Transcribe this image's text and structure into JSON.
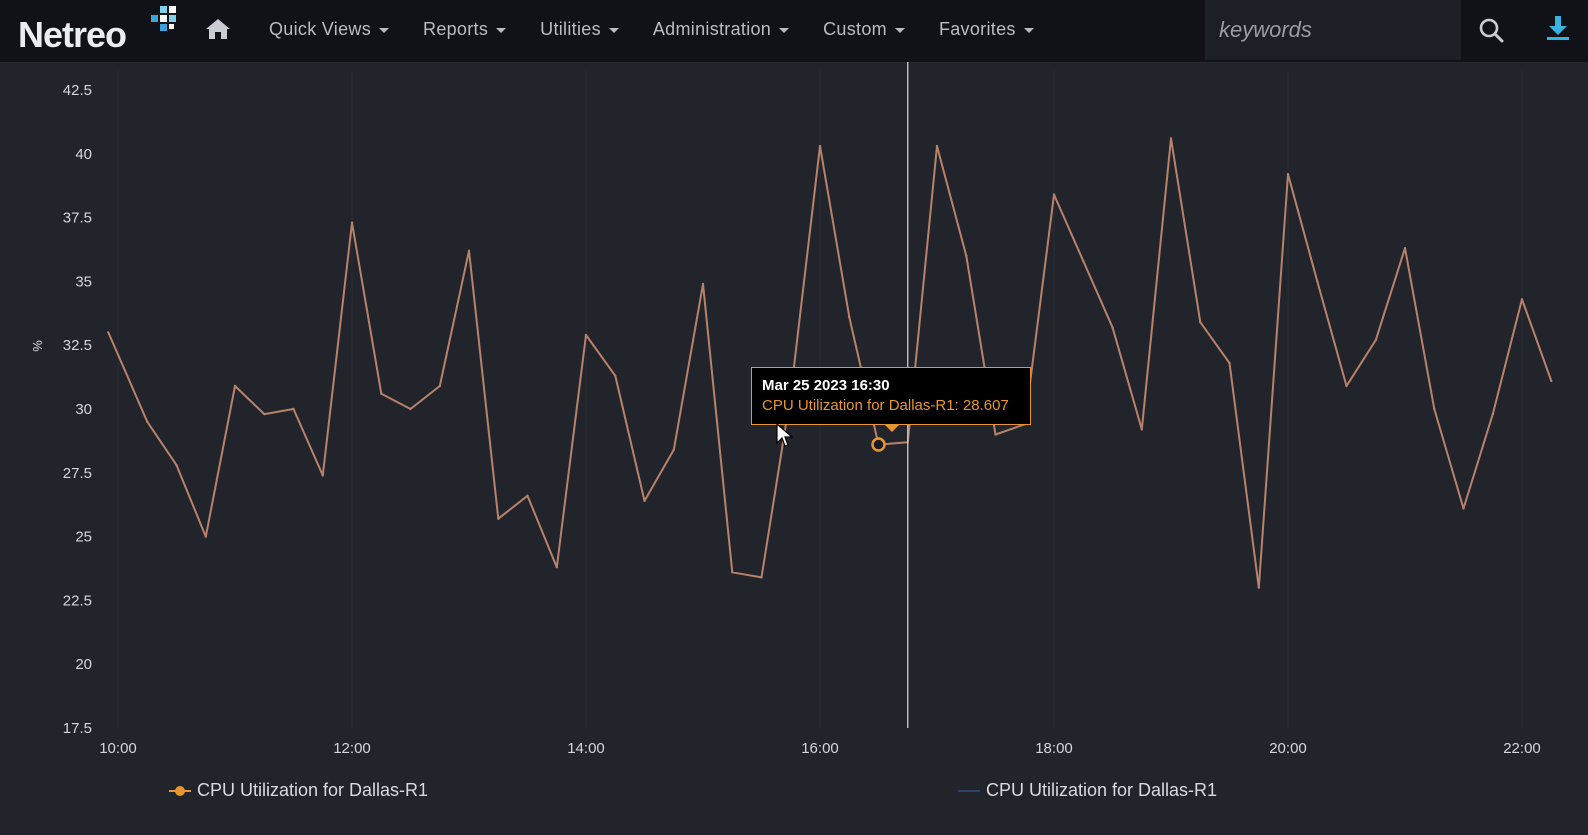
{
  "topbar": {
    "logo_text": "Netreo",
    "nav": [
      {
        "label": "Quick Views"
      },
      {
        "label": "Reports"
      },
      {
        "label": "Utilities"
      },
      {
        "label": "Administration"
      },
      {
        "label": "Custom"
      },
      {
        "label": "Favorites"
      }
    ],
    "search": {
      "placeholder": "keywords",
      "value": ""
    },
    "icons": {
      "home": "home-icon",
      "search": "search-icon",
      "download": "download-icon"
    }
  },
  "colors": {
    "accent": "#e8962f",
    "series_line": "#b8826a",
    "second_series": "#2e4166",
    "background": "#22242c"
  },
  "tooltip": {
    "title": "Mar 25 2023 16:30",
    "value_text": "CPU Utilization for Dallas-R1: 28.607"
  },
  "chart_data": {
    "type": "line",
    "title": "",
    "xlabel": "",
    "ylabel": "%",
    "ylim": [
      17.5,
      42.5
    ],
    "yticks": [
      "17.5",
      "20",
      "22.5",
      "25",
      "27.5",
      "30",
      "32.5",
      "35",
      "37.5",
      "40",
      "42.5"
    ],
    "xlim": [
      "10:00",
      "22:15"
    ],
    "xticks": [
      "10:00",
      "12:00",
      "14:00",
      "16:00",
      "18:00",
      "20:00",
      "22:00"
    ],
    "hover_x": "16:45",
    "marker": {
      "x": "16:30",
      "y": 28.607
    },
    "legend": [
      {
        "label": "CPU Utilization for Dallas-R1",
        "color": "#e8962f"
      },
      {
        "label": "CPU Utilization for Dallas-R1",
        "color": "#2e4166"
      }
    ],
    "series": [
      {
        "x": [
          "09:55",
          "10:15",
          "10:30",
          "10:45",
          "11:00",
          "11:15",
          "11:30",
          "11:45",
          "12:00",
          "12:15",
          "12:30",
          "12:45",
          "13:00",
          "13:15",
          "13:30",
          "13:45",
          "14:00",
          "14:15",
          "14:30",
          "14:45",
          "15:00",
          "15:15",
          "15:30",
          "15:45",
          "16:00",
          "16:15",
          "16:30",
          "16:45",
          "17:00",
          "17:15",
          "17:30",
          "17:45",
          "18:00",
          "18:15",
          "18:30",
          "18:45",
          "19:00",
          "19:15",
          "19:30",
          "19:45",
          "20:00",
          "20:15",
          "20:30",
          "20:45",
          "21:00",
          "21:15",
          "21:30",
          "21:45",
          "22:00",
          "22:15"
        ],
        "values": [
          33,
          29.5,
          27.8,
          25,
          30.9,
          29.8,
          30,
          27.4,
          37.3,
          30.6,
          30,
          30.9,
          36.2,
          25.7,
          26.6,
          23.8,
          32.9,
          31.3,
          26.4,
          28.4,
          34.9,
          23.6,
          23.4,
          30.6,
          40.3,
          33.6,
          28.6,
          28.7,
          40.3,
          36,
          29,
          29.4,
          38.4,
          35.8,
          33.2,
          29.2,
          40.6,
          33.4,
          31.8,
          23,
          39.2,
          35,
          30.9,
          32.7,
          36.3,
          30,
          26.1,
          29.8,
          34.3,
          31.1
        ]
      }
    ]
  },
  "legend_icons": {
    "first": "orange-dot-line-icon",
    "second": "navy-line-icon"
  }
}
